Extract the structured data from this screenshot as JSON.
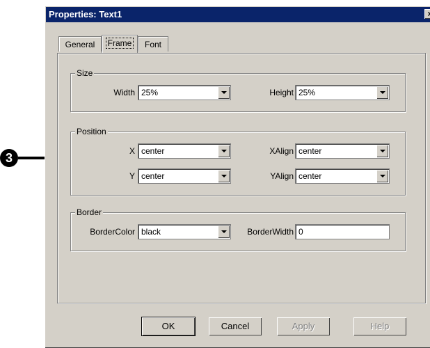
{
  "dialog": {
    "title": "Properties: Text1",
    "close_label": "×"
  },
  "tabs": [
    {
      "label": "General"
    },
    {
      "label": "Frame",
      "active": true
    },
    {
      "label": "Font"
    }
  ],
  "size_group": {
    "legend": "Size",
    "width_label": "Width",
    "width_value": "25%",
    "height_label": "Height",
    "height_value": "25%"
  },
  "position_group": {
    "legend": "Position",
    "x_label": "X",
    "x_value": "center",
    "y_label": "Y",
    "y_value": "center",
    "xalign_label": "XAlign",
    "xalign_value": "center",
    "yalign_label": "YAlign",
    "yalign_value": "center"
  },
  "border_group": {
    "legend": "Border",
    "color_label": "BorderColor",
    "color_value": "black",
    "width_label": "BorderWidth",
    "width_value": "0"
  },
  "buttons": {
    "ok": "OK",
    "cancel": "Cancel",
    "apply": "Apply",
    "help": "Help"
  },
  "callout": {
    "number": "3"
  },
  "colors": {
    "face": "#d4d0c8",
    "titlebar": "#0a246a"
  }
}
